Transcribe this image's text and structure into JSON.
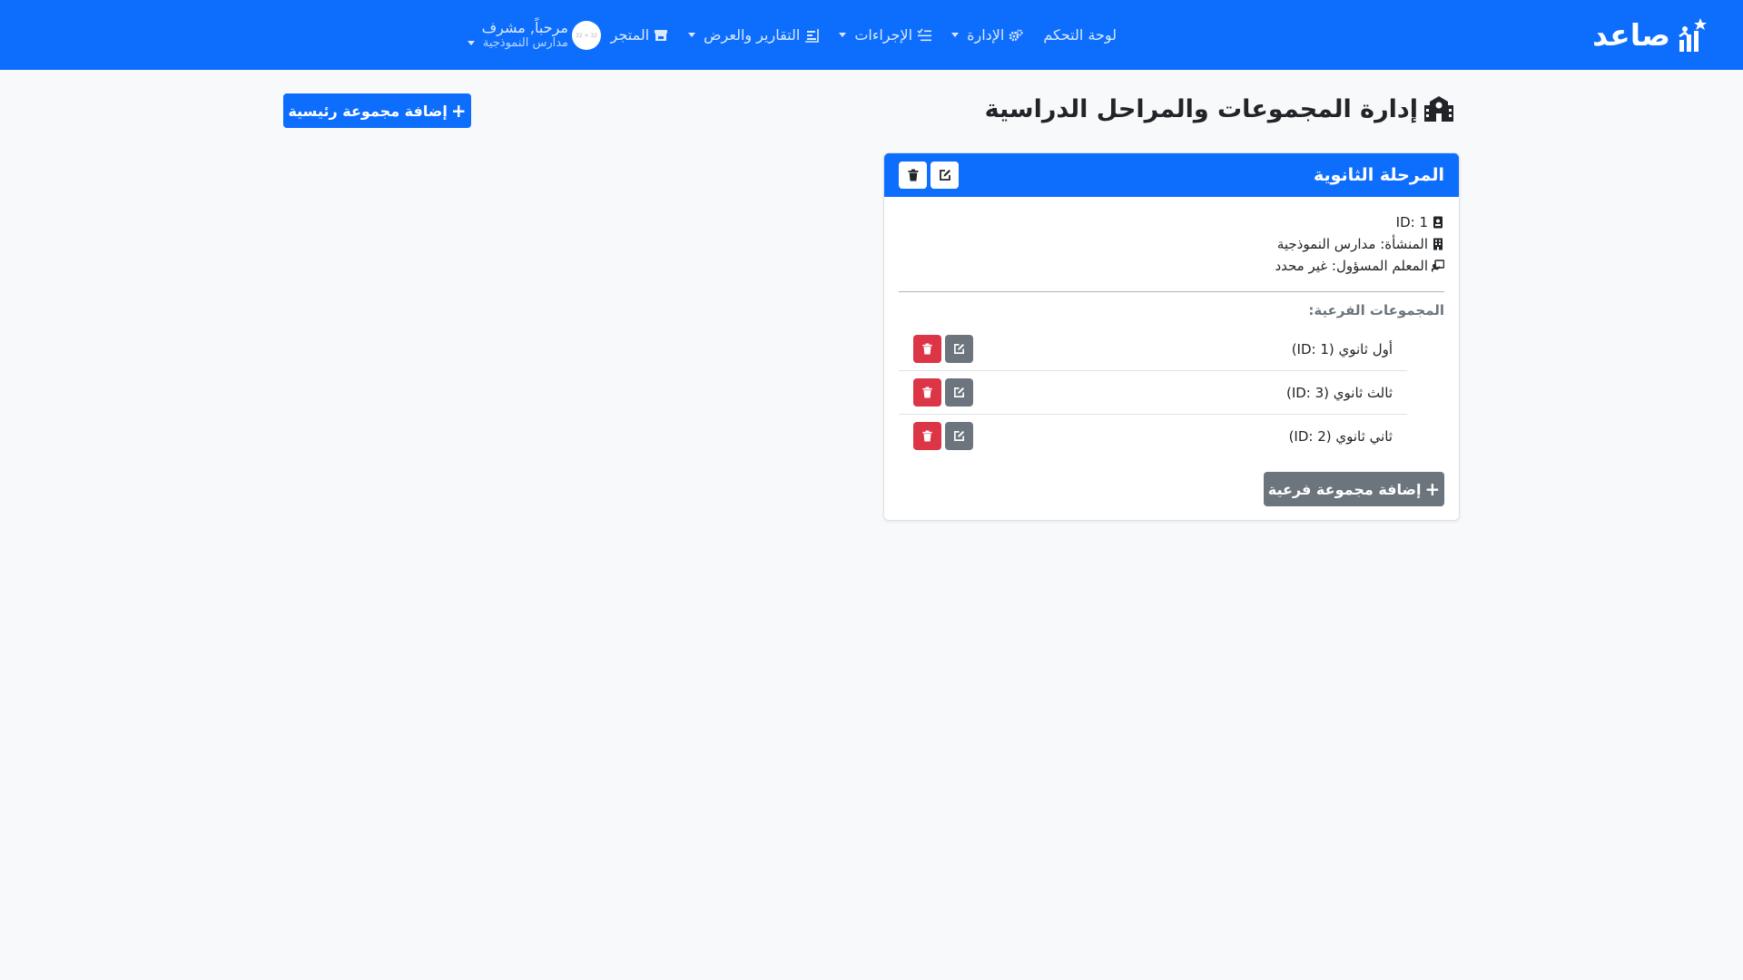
{
  "app": {
    "brand": "صاعد"
  },
  "nav": {
    "items": [
      {
        "label": "لوحة التحكم",
        "icon": "",
        "dropdown": false
      },
      {
        "label": "الإدارة",
        "icon": "gears-icon",
        "dropdown": true
      },
      {
        "label": "الإجراءات",
        "icon": "list-check-icon",
        "dropdown": true
      },
      {
        "label": "التقارير والعرض",
        "icon": "chart-icon",
        "dropdown": true
      },
      {
        "label": "المتجر",
        "icon": "store-icon",
        "dropdown": false
      }
    ],
    "user": {
      "greeting": "مرحباً, مشرف",
      "org": "مدارس النموذجية",
      "avatar_text": "32 × 32"
    }
  },
  "page": {
    "title": "إدارة المجموعات والمراحل الدراسية",
    "add_main_label": "إضافة مجموعة رئيسية"
  },
  "card": {
    "title": "المرحلة الثانوية",
    "id_line": "ID: 1",
    "facility_line": "المنشأة: مدارس النموذجية",
    "teacher_line": "المعلم المسؤول: غير محدد",
    "subgroups_title": "المجموعات الفرعية:",
    "subgroups": [
      {
        "name": "أول ثانوي (ID: 1)"
      },
      {
        "name": "ثالث ثانوي (ID: 3)"
      },
      {
        "name": "ثاني ثانوي (ID: 2)"
      }
    ],
    "add_sub_label": "إضافة مجموعة فرعية"
  },
  "colors": {
    "primary": "#0d6efd",
    "danger": "#dc3545",
    "secondary": "#6c757d",
    "background": "#f8f9fa"
  }
}
